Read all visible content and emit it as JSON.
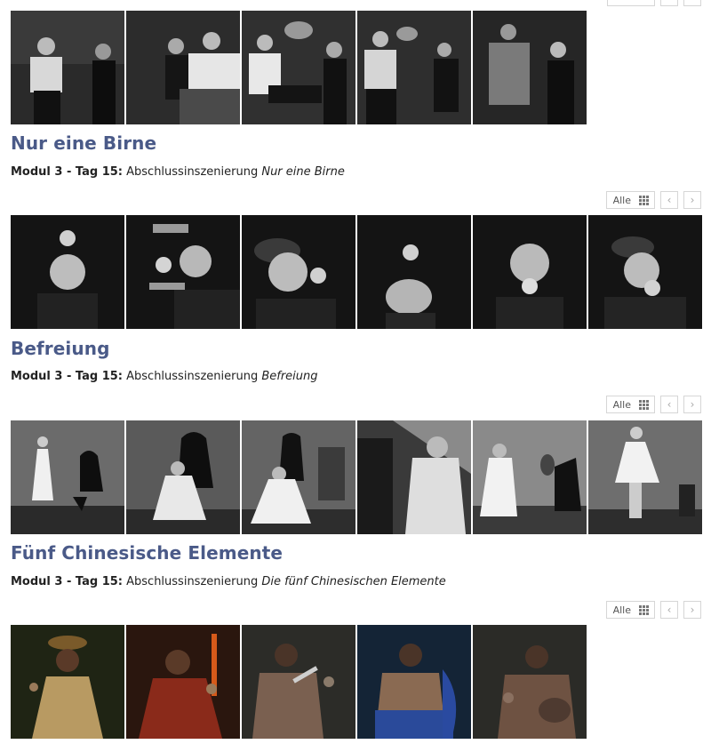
{
  "galleries": [
    {
      "thumb_names": [
        "bar-scene-1",
        "bar-scene-2",
        "bar-scene-3",
        "bar-scene-4",
        "bar-scene-5"
      ]
    },
    {
      "title": "Nur eine Birne",
      "module": "Modul 3 - Tag 15:",
      "text": " Abschlussinszenierung ",
      "emph": "Nur eine Birne",
      "controls": {
        "all_label": "Alle",
        "prev": "‹",
        "next": "›"
      }
    },
    {
      "title": "Befreiung",
      "module": "Modul 3 - Tag 15:",
      "text": " Abschlussinszenierung ",
      "emph": "Befreiung",
      "controls": {
        "all_label": "Alle",
        "prev": "‹",
        "next": "›"
      }
    },
    {
      "title": "Fünf Chinesische Elemente",
      "module": "Modul 3 - Tag 15:",
      "text": " Abschlussinszenierung ",
      "emph": "Die fünf Chinesischen Elemente",
      "controls": {
        "all_label": "Alle",
        "prev": "‹",
        "next": "›"
      }
    }
  ],
  "colors": {
    "title": "#4a5a88",
    "control_border": "#d6d6d6"
  }
}
